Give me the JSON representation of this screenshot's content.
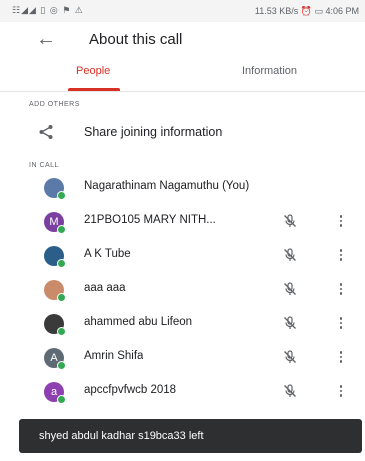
{
  "status_bar": {
    "left_icons": "☷◢◢ ▯ ◎ ⚑ ⚠",
    "right_text": "11.53 KB/s ⏰ ▭ 4:06 PM"
  },
  "header": {
    "back_icon": "arrow-left-icon",
    "title": "About this call"
  },
  "tabs": [
    {
      "label": "People",
      "active": true
    },
    {
      "label": "Information",
      "active": false
    }
  ],
  "add_others": {
    "section_label": "ADD OTHERS",
    "share_label": "Share joining information",
    "share_icon": "share-icon"
  },
  "in_call": {
    "section_label": "IN CALL",
    "participants": [
      {
        "name": "Nagarathinam Nagamuthu (You)",
        "avatar_letter": "",
        "avatar_color": "#5b7aa8",
        "muted_icon": false
      },
      {
        "name": "21PBO105 MARY NITH...",
        "avatar_letter": "M",
        "avatar_color": "#7b3fa0",
        "muted_icon": true
      },
      {
        "name": "A K Tube",
        "avatar_letter": "",
        "avatar_color": "#2b5f8a",
        "muted_icon": true
      },
      {
        "name": "aaa aaa",
        "avatar_letter": "",
        "avatar_color": "#c98b6a",
        "muted_icon": true
      },
      {
        "name": "ahammed abu Lifeon",
        "avatar_letter": "",
        "avatar_color": "#3a3a3a",
        "muted_icon": true
      },
      {
        "name": "Amrin Shifa",
        "avatar_letter": "A",
        "avatar_color": "#5f6b74",
        "muted_icon": true
      },
      {
        "name": "apccfpvfwcb 2018",
        "avatar_letter": "a",
        "avatar_color": "#8e3fb0",
        "muted_icon": true
      }
    ]
  },
  "toast": {
    "text": "shyed abdul kadhar s19bca33 left"
  },
  "colors": {
    "accent": "#d93025",
    "online": "#34a853",
    "toast_bg": "#2d2f31"
  }
}
